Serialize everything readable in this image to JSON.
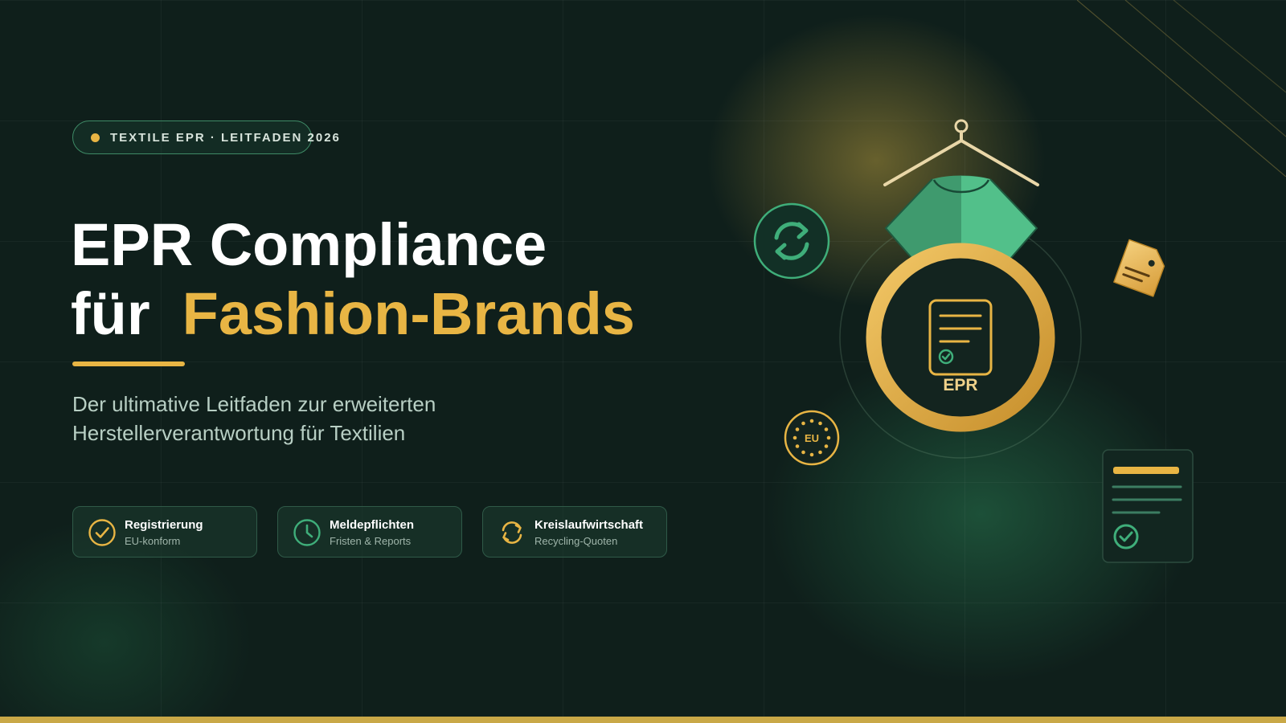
{
  "badge": {
    "text": "TEXTILE EPR · LEITFADEN 2026"
  },
  "title": {
    "line1": "EPR Compliance",
    "line2_prefix": "für",
    "line2_accent": "Fashion-Brands"
  },
  "subtitle": {
    "line1": "Der ultimative Leitfaden zur erweiterten",
    "line2": "Herstellerverantwortung für Textilien"
  },
  "features": [
    {
      "title": "Registrierung",
      "subtitle": "EU-konform",
      "icon": "check-circle-icon"
    },
    {
      "title": "Meldepflichten",
      "subtitle": "Fristen & Reports",
      "icon": "clock-icon"
    },
    {
      "title": "Kreislaufwirtschaft",
      "subtitle": "Recycling-Quoten",
      "icon": "recycle-icon"
    }
  ],
  "illustration": {
    "center_label": "EPR",
    "eu_label": "EU"
  },
  "colors": {
    "background": "#0f1f1b",
    "accent_gold": "#e8b544",
    "accent_green": "#3fae7a",
    "text_white": "#ffffff",
    "text_muted": "#b8cfc4"
  }
}
